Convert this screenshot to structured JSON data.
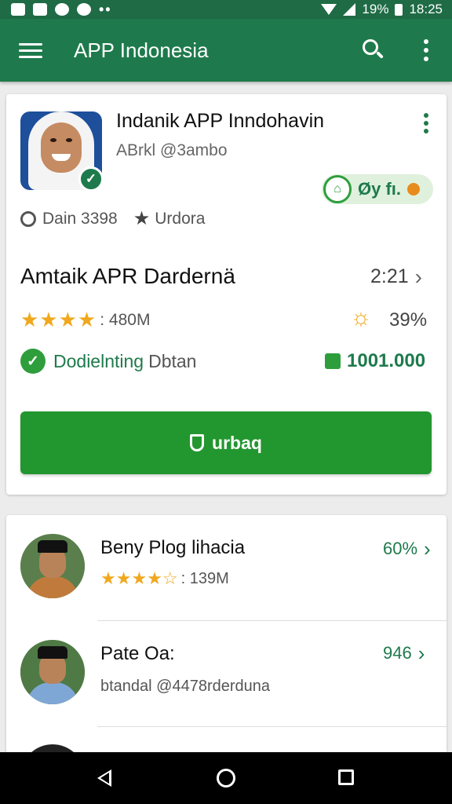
{
  "status_bar": {
    "battery": "19%",
    "time": "18:25"
  },
  "app_bar": {
    "title": "APP Indonesia"
  },
  "featured": {
    "app_name": "Indanik APP Inndohavin",
    "developer": "ABrkl @3ambo",
    "badge_text": "Øy fı.",
    "meta_left": "Dain 3398",
    "meta_right": "Urdora",
    "title": "Amtaik APR Dardernä",
    "title_value": "2:21",
    "rating_stars": "★★★★",
    "rating_count": ": 480M",
    "percent": "39%",
    "status_label": "Dodielnting",
    "status_extra": "Dbtan",
    "downloads": "1001.000",
    "install_label": "urbaq"
  },
  "list": {
    "items": [
      {
        "name": "Beny Plog lihacia",
        "stars": "★★★★☆",
        "sub": ": 139M",
        "right": "60%"
      },
      {
        "name": "Pate Oa:",
        "stars": "",
        "sub": "btandal @4478rderduna",
        "right": "946"
      }
    ]
  },
  "colors": {
    "primary": "#1e7a4c",
    "accent_green": "#22962f",
    "star": "#f0a81e"
  },
  "icons": {
    "menu": "hamburger-icon",
    "search": "search-icon",
    "more": "overflow-icon",
    "nav": [
      "back-icon",
      "home-icon",
      "recents-icon"
    ]
  }
}
